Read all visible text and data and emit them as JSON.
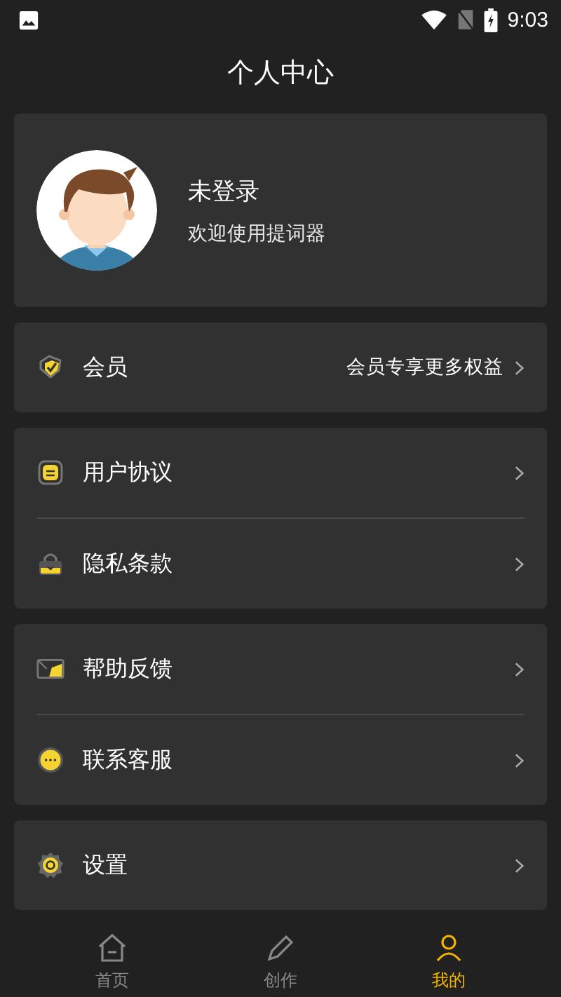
{
  "status_bar": {
    "time": "9:03"
  },
  "title": "个人中心",
  "profile": {
    "name": "未登录",
    "subtitle": "欢迎使用提词器"
  },
  "groups": [
    {
      "items": [
        {
          "kind": "vip",
          "label": "会员",
          "hint": "会员专享更多权益"
        }
      ]
    },
    {
      "items": [
        {
          "kind": "doc",
          "label": "用户协议"
        },
        {
          "kind": "lock",
          "label": "隐私条款"
        }
      ]
    },
    {
      "items": [
        {
          "kind": "mail",
          "label": "帮助反馈"
        },
        {
          "kind": "chat",
          "label": "联系客服"
        }
      ]
    },
    {
      "items": [
        {
          "kind": "gear",
          "label": "设置"
        }
      ]
    }
  ],
  "bottom_nav": [
    {
      "kind": "home",
      "label": "首页",
      "selected": false
    },
    {
      "kind": "pen",
      "label": "创作",
      "selected": false
    },
    {
      "kind": "user",
      "label": "我的",
      "selected": true
    }
  ]
}
